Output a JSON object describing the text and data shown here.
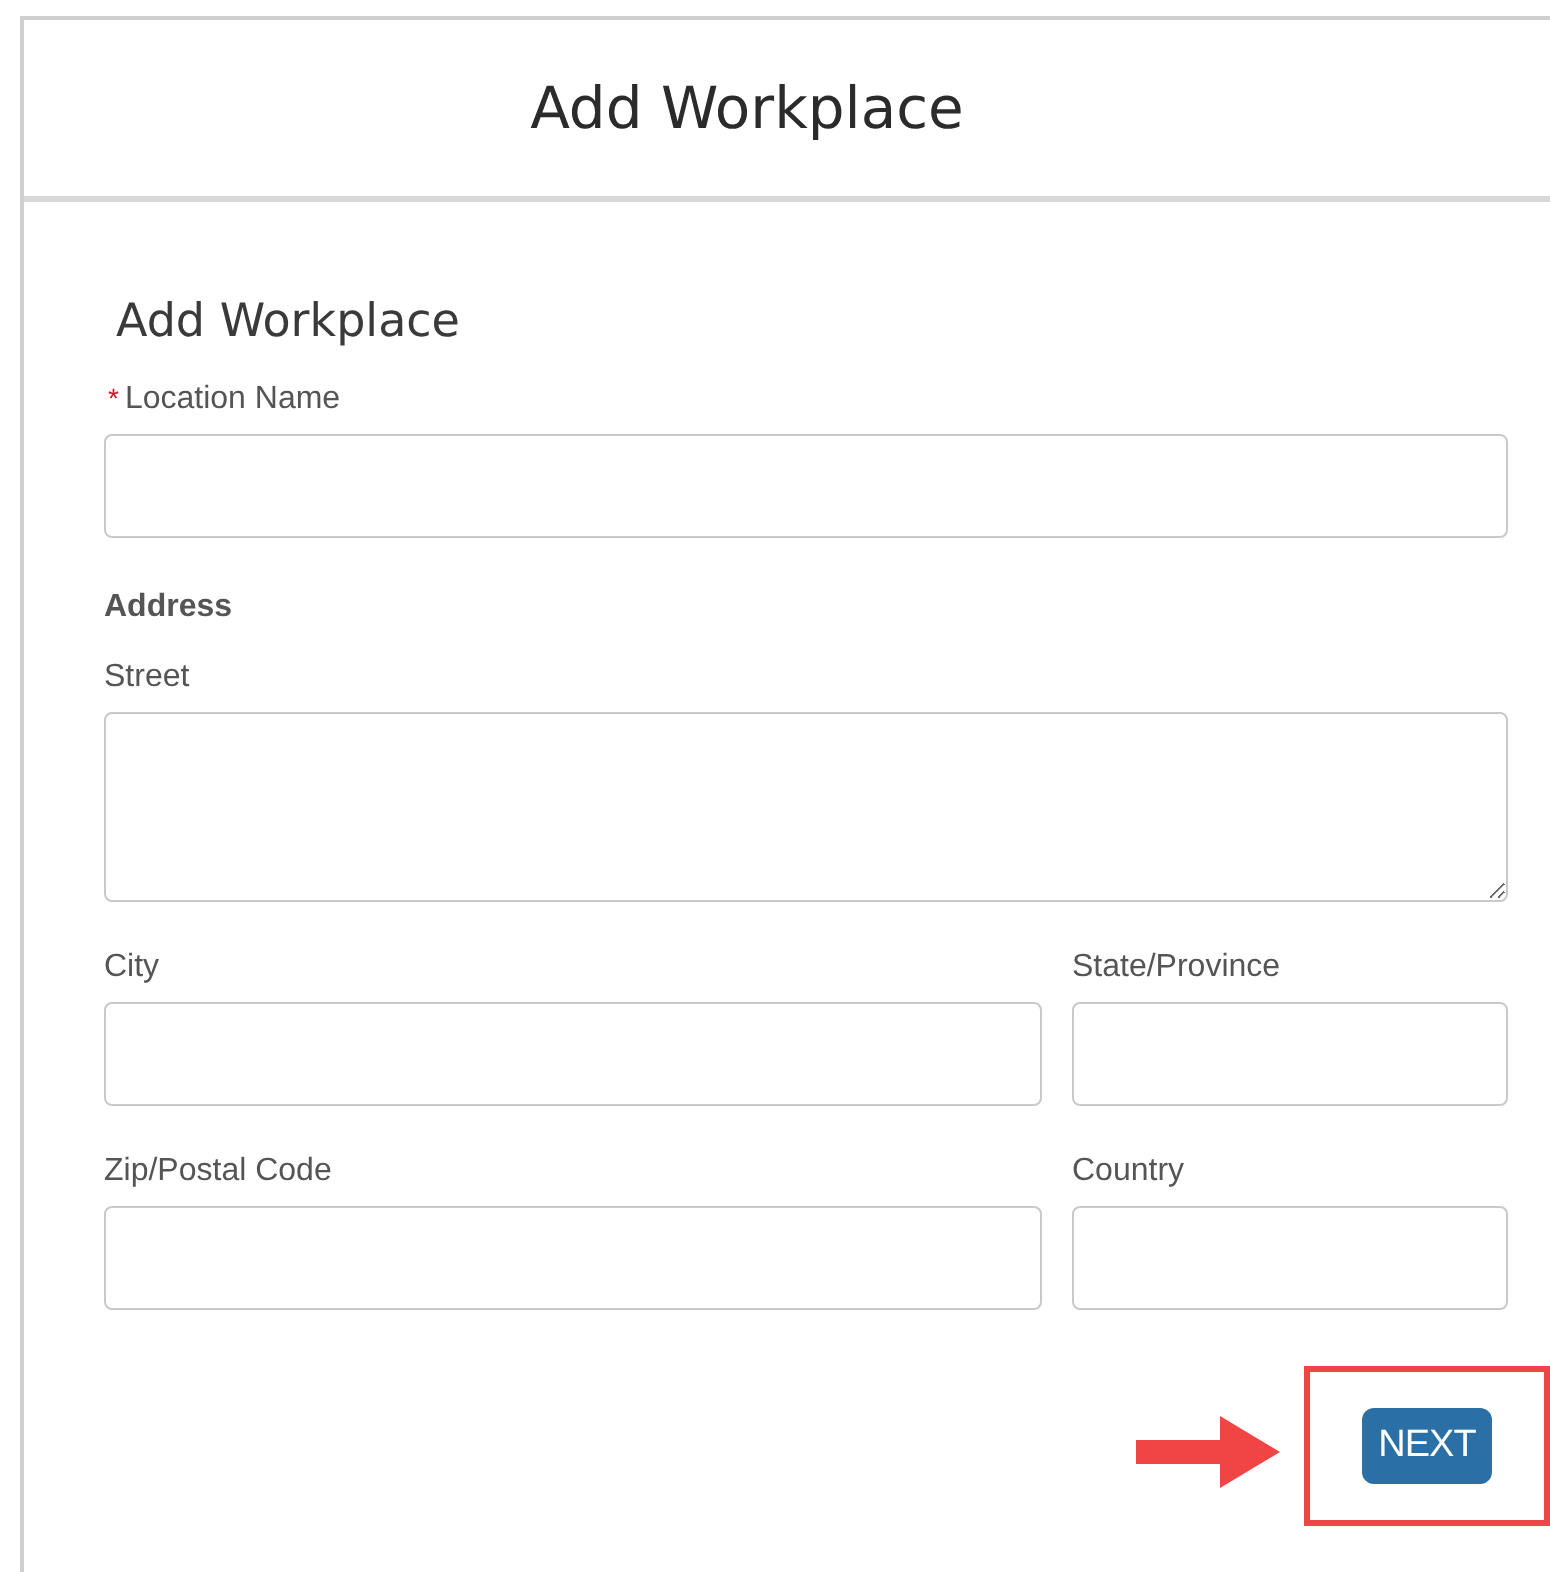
{
  "header": {
    "title": "Add Workplace"
  },
  "form": {
    "heading": "Add Workplace",
    "location_name": {
      "label": "Location Name",
      "required": true,
      "required_mark": "*"
    },
    "address": {
      "label": "Address",
      "street": {
        "label": "Street"
      },
      "rows": [
        [
          {
            "label": "City"
          },
          {
            "label": "State/Province"
          }
        ],
        [
          {
            "label": "Zip/Postal Code"
          },
          {
            "label": "Country"
          }
        ]
      ]
    }
  },
  "next_button": {
    "label": "NEXT",
    "highlighted": true
  }
}
